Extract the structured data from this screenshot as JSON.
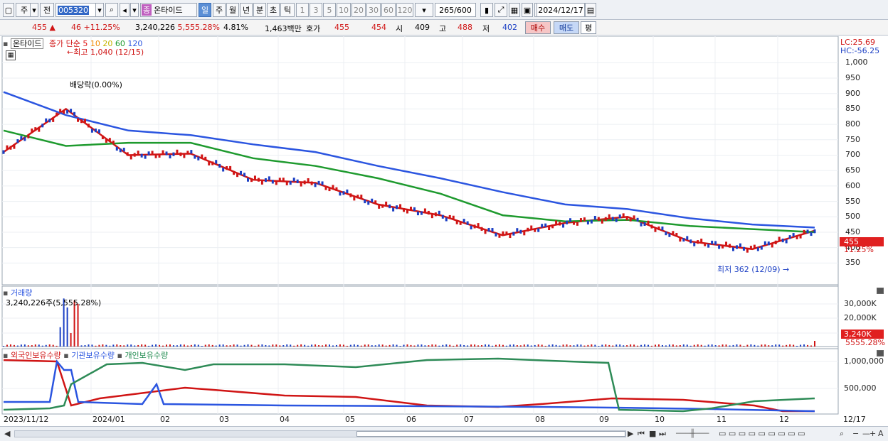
{
  "toolbar": {
    "mode_selector": "주",
    "item_selector": "전",
    "stock_code": "005320",
    "stock_name": "온타이드",
    "stock_badge": "종",
    "periods": [
      "일",
      "주",
      "월",
      "년",
      "분",
      "초",
      "틱"
    ],
    "selected_period": "일",
    "intervals": [
      "1",
      "3",
      "5",
      "10",
      "20",
      "30",
      "60",
      "120"
    ],
    "count_value": "265",
    "count_total": "/600",
    "date": "2024/12/17"
  },
  "quote": {
    "price": "455",
    "change_arrow": "▲",
    "change": "46",
    "change_pct": "+11.25%",
    "volume": "3,240,226",
    "volume_pct": "5,555.28%",
    "turnover_pct": "4.81%",
    "trade_value": "1,463백만",
    "bid_label": "호가",
    "ask": "455",
    "bid": "454",
    "open_label": "시",
    "open": "409",
    "high_label": "고",
    "high": "488",
    "low_label": "저",
    "low": "402",
    "buy_button": "매수",
    "sell_button": "매도",
    "eval_button": "평"
  },
  "price_panel": {
    "name": "온타이드",
    "legend_label": "종가 단순",
    "ma": [
      {
        "label": "5",
        "color": "#e01010"
      },
      {
        "label": "10",
        "color": "#f08a00"
      },
      {
        "label": "20",
        "color": "#e6d600"
      },
      {
        "label": "60",
        "color": "#1e9a2e"
      },
      {
        "label": "120",
        "color": "#2b55e0"
      }
    ],
    "high_note": "최고 1,040 (12/15)",
    "dividend_note": "배당락(0.00%)",
    "low_note": "최저 362 (12/09)",
    "lc": "LC:25.69",
    "hc": "HC:-56.25",
    "y_ticks": [
      "1,000",
      "950",
      "900",
      "850",
      "800",
      "750",
      "700",
      "650",
      "600",
      "550",
      "500",
      "450",
      "400",
      "350"
    ],
    "current_price_tag": "455",
    "current_pct_tag": "11.25%"
  },
  "volume_panel": {
    "title": "거래량",
    "summary": "3,240,226주(5,555.28%)",
    "y_ticks": [
      "30,000K",
      "20,000K",
      "10,000K"
    ],
    "current_tag": "3,240K",
    "current_pct": "5555.28%"
  },
  "holdings_panel": {
    "legend": [
      {
        "label": "외국인보유수량",
        "color": "#d01515"
      },
      {
        "label": "기관보유수량",
        "color": "#2b55e0"
      },
      {
        "label": "개인보유수량",
        "color": "#1e8a4e"
      }
    ],
    "y_ticks": [
      "1,000,000",
      "500,000"
    ]
  },
  "x_axis": [
    "2023/11/12",
    "2024/01",
    "02",
    "03",
    "04",
    "05",
    "06",
    "07",
    "08",
    "09",
    "10",
    "11",
    "12",
    "12/17"
  ],
  "chart_data": {
    "type": "line",
    "x": [
      "2023/11/12",
      "2024/01",
      "02",
      "03",
      "04",
      "05",
      "06",
      "07",
      "08",
      "09",
      "10",
      "11",
      "12",
      "12/17"
    ],
    "series": [
      {
        "name": "5",
        "values": [
          710,
          850,
          700,
          705,
          620,
          610,
          540,
          505,
          440,
          480,
          500,
          420,
          395,
          455
        ]
      },
      {
        "name": "60",
        "values": [
          780,
          730,
          740,
          740,
          690,
          665,
          625,
          575,
          505,
          485,
          490,
          470,
          460,
          450
        ]
      },
      {
        "name": "120",
        "values": [
          905,
          830,
          780,
          765,
          735,
          710,
          665,
          625,
          580,
          540,
          525,
          495,
          475,
          465
        ]
      }
    ],
    "ylim": [
      330,
      1040
    ]
  }
}
